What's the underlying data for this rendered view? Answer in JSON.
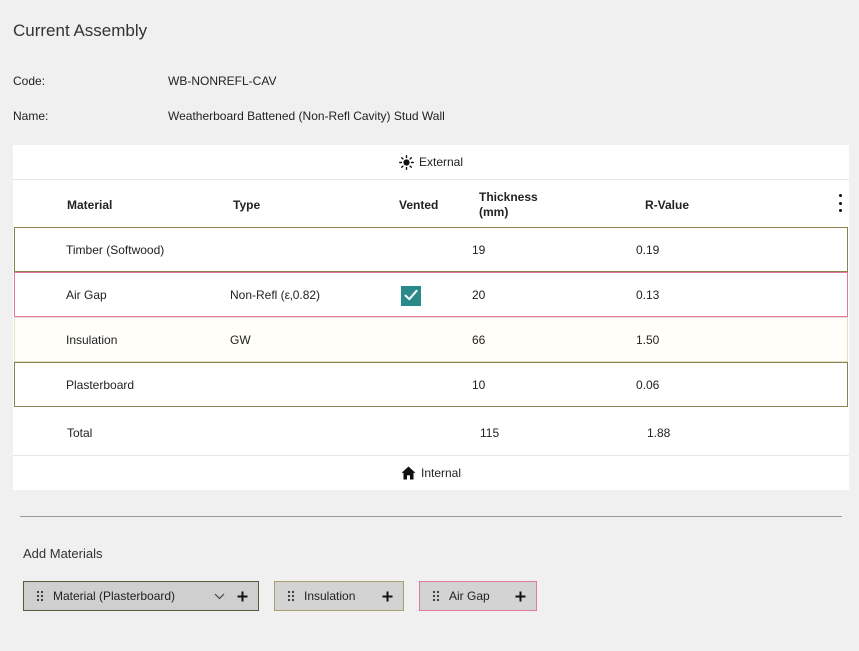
{
  "page": {
    "title": "Current Assembly"
  },
  "meta": {
    "code_label": "Code:",
    "code_value": "WB-NONREFL-CAV",
    "name_label": "Name:",
    "name_value": "Weatherboard Battened (Non-Refl Cavity) Stud Wall"
  },
  "boundaries": {
    "external": {
      "label": "External",
      "icon": "sun-icon"
    },
    "internal": {
      "label": "Internal",
      "icon": "home-icon"
    }
  },
  "table": {
    "headers": {
      "material": "Material",
      "type": "Type",
      "vented": "Vented",
      "thickness": "Thickness\n(mm)",
      "rvalue": "R-Value"
    },
    "menu_icon": "more-vertical-icon",
    "rows": [
      {
        "material": "Timber (Softwood)",
        "type": "",
        "vented": false,
        "thickness": "19",
        "rvalue": "0.19",
        "color": "#8a8250",
        "bg": "#ffffff"
      },
      {
        "material": "Air Gap",
        "type": "Non-Refl (ε‚0.82)",
        "vented": true,
        "thickness": "20",
        "rvalue": "0.13",
        "color": "#e07aa0",
        "bg": "#ffffff"
      },
      {
        "material": "Insulation",
        "type": "GW",
        "vented": false,
        "thickness": "66",
        "rvalue": "1.50",
        "color": "#e4dfc6",
        "bg": "#fffef8"
      },
      {
        "material": "Plasterboard",
        "type": "",
        "vented": false,
        "thickness": "10",
        "rvalue": "0.06",
        "color": "#8a8250",
        "bg": "#ffffff"
      }
    ],
    "total": {
      "label": "Total",
      "thickness": "115",
      "rvalue": "1.88"
    }
  },
  "add_materials": {
    "title": "Add Materials",
    "chips": [
      {
        "label": "Material (Plasterboard)",
        "has_dropdown": true,
        "border": "#5a5a3a",
        "bg": "#cfcfcf"
      },
      {
        "label": "Insulation",
        "has_dropdown": false,
        "border": "#a8a070",
        "bg": "#d3d3d3"
      },
      {
        "label": "Air Gap",
        "has_dropdown": false,
        "border": "#e07aa0",
        "bg": "#d3d3d3"
      }
    ]
  },
  "colors": {
    "accent_checkbox": "#2a8a8a",
    "background": "#f0f0f0",
    "card": "#ffffff"
  }
}
